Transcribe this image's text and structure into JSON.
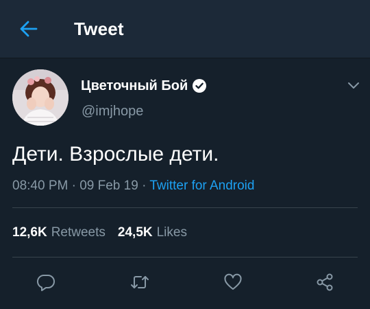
{
  "header": {
    "title": "Tweet",
    "back_icon": "arrow-left-icon",
    "accent_color": "#1da1f2"
  },
  "tweet": {
    "author": {
      "display_name": "Цветочный Бой",
      "handle": "@imjhope",
      "verified": true
    },
    "text": "Дети. Взрослые дети.",
    "meta": {
      "time": "08:40 PM",
      "separator1": " · ",
      "date": "09 Feb 19",
      "separator2": " · ",
      "source": "Twitter for Android"
    },
    "stats": {
      "retweets_count": "12,6K",
      "retweets_label": "Retweets",
      "likes_count": "24,5K",
      "likes_label": "Likes"
    }
  },
  "actions": [
    "reply-icon",
    "retweet-icon",
    "like-icon",
    "share-icon"
  ],
  "colors": {
    "background": "#15202b",
    "app_bar": "#1c2938",
    "secondary_text": "#8899a6",
    "divider": "#38444d"
  }
}
